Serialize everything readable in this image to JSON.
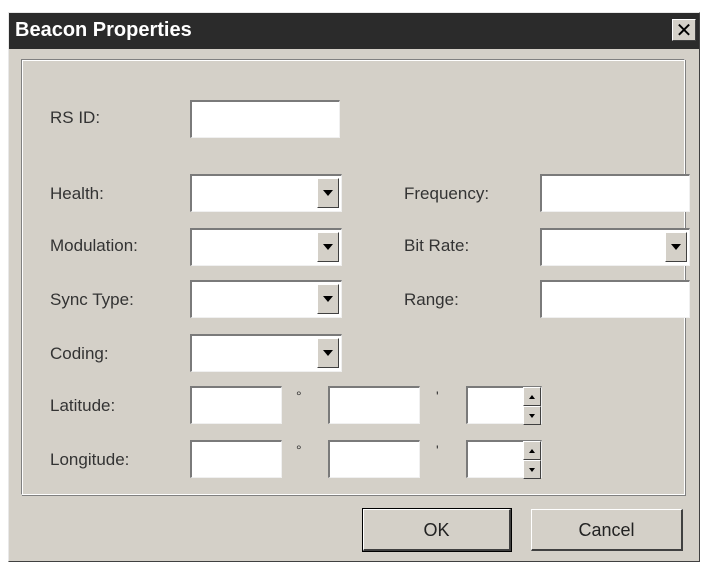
{
  "window": {
    "title": "Beacon Properties",
    "close_glyph": "✕"
  },
  "labels": {
    "rs_id": "RS ID:",
    "health": "Health:",
    "modulation": "Modulation:",
    "sync_type": "Sync Type:",
    "coding": "Coding:",
    "latitude": "Latitude:",
    "longitude": "Longitude:",
    "frequency": "Frequency:",
    "bit_rate": "Bit Rate:",
    "range": "Range:"
  },
  "values": {
    "rs_id": "",
    "health": "",
    "modulation": "",
    "sync_type": "",
    "coding": "",
    "frequency": "",
    "bit_rate": "",
    "range": "",
    "lat_deg": "",
    "lat_min": "",
    "lat_sec": "",
    "lon_deg": "",
    "lon_min": "",
    "lon_sec": ""
  },
  "symbols": {
    "degree": "°",
    "minute": "'"
  },
  "buttons": {
    "ok": "OK",
    "cancel": "Cancel"
  },
  "icons": {
    "combo": "dropdown-arrow",
    "spin": "spinner-arrows",
    "close": "close-icon"
  }
}
